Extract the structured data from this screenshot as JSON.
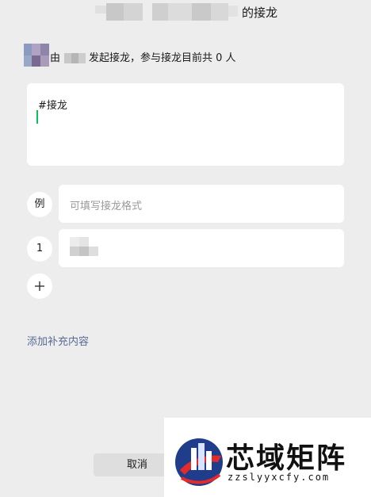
{
  "header": {
    "title_suffix": "的接龙"
  },
  "subtitle": {
    "prefix": "由",
    "text": "发起接龙，参与接龙目前共 0 人"
  },
  "editor": {
    "text": "#接龙"
  },
  "rows": [
    {
      "badge": "例",
      "placeholder": "可填写接龙格式"
    },
    {
      "badge": "1",
      "value": ""
    }
  ],
  "add_icon": "plus-icon",
  "supplement_link": "添加补充内容",
  "cancel_label": "取消",
  "watermark": {
    "title": "芯域矩阵",
    "url": "zzslyyxcfy.com"
  },
  "colors": {
    "accent_green": "#07c160",
    "link_blue": "#576b95"
  }
}
